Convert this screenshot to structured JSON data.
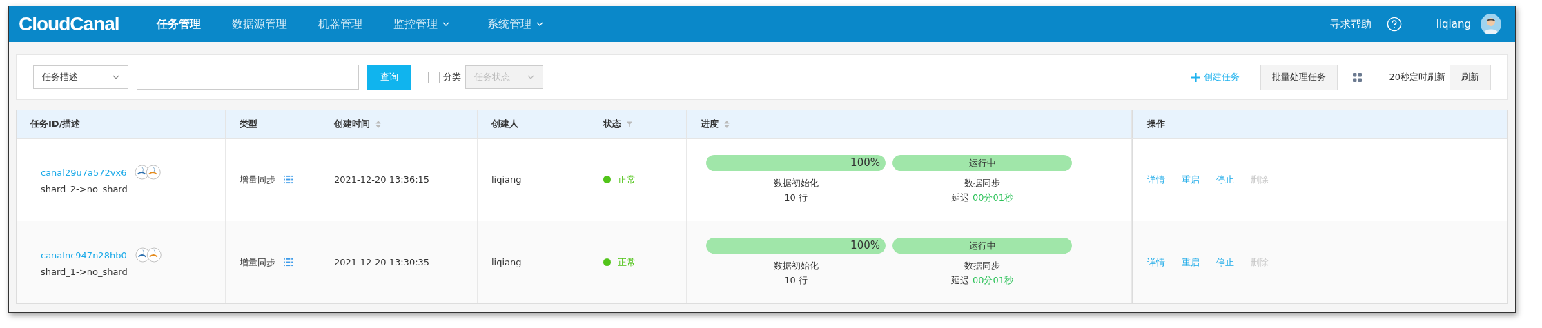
{
  "header": {
    "logo": "CloudCanal",
    "nav": [
      {
        "label": "任务管理",
        "selected": true,
        "dropdown": false
      },
      {
        "label": "数据源管理",
        "selected": false,
        "dropdown": false
      },
      {
        "label": "机器管理",
        "selected": false,
        "dropdown": false
      },
      {
        "label": "监控管理",
        "selected": false,
        "dropdown": true
      },
      {
        "label": "系统管理",
        "selected": false,
        "dropdown": true
      }
    ],
    "help": "寻求帮助",
    "user": "liqiang"
  },
  "toolbar": {
    "filter_select": "任务描述",
    "query_button": "查询",
    "category": {
      "label": "分类",
      "checked": false
    },
    "status_select": {
      "placeholder": "任务状态",
      "disabled": true
    },
    "create_button": "创建任务",
    "batch_button": "批量处理任务",
    "auto_refresh": {
      "label": "20秒定时刷新",
      "checked": false
    },
    "refresh_button": "刷新"
  },
  "table": {
    "columns": [
      {
        "label": "任务ID/描述",
        "sort": false,
        "filter": false
      },
      {
        "label": "类型",
        "sort": false,
        "filter": false
      },
      {
        "label": "创建时间",
        "sort": true,
        "filter": false
      },
      {
        "label": "创建人",
        "sort": false,
        "filter": false
      },
      {
        "label": "状态",
        "sort": false,
        "filter": true
      },
      {
        "label": "进度",
        "sort": true,
        "filter": false
      },
      {
        "label": "操作",
        "sort": false,
        "filter": false
      }
    ],
    "rows": [
      {
        "id": "canal29u7a572vx6",
        "desc": "shard_2->no_shard",
        "type": "增量同步",
        "created": "2021-12-20 13:36:15",
        "creator": "liqiang",
        "status": {
          "label": "正常",
          "color": "#52c41a"
        },
        "init": {
          "bar_text": "100%",
          "level": 1,
          "label": "数据初始化",
          "detail": "10 行"
        },
        "sync": {
          "bar_text": "运行中",
          "level": 1,
          "label": "数据同步",
          "delay_label": "延迟",
          "delay": "00分01秒"
        },
        "actions": [
          {
            "label": "详情",
            "disabled": false
          },
          {
            "label": "重启",
            "disabled": false
          },
          {
            "label": "停止",
            "disabled": false
          },
          {
            "label": "删除",
            "disabled": true
          }
        ]
      },
      {
        "id": "canalnc947n28hb0",
        "desc": "shard_1->no_shard",
        "type": "增量同步",
        "created": "2021-12-20 13:30:35",
        "creator": "liqiang",
        "status": {
          "label": "正常",
          "color": "#52c41a"
        },
        "init": {
          "bar_text": "100%",
          "level": 1,
          "label": "数据初始化",
          "detail": "10 行"
        },
        "sync": {
          "bar_text": "运行中",
          "level": 1,
          "label": "数据同步",
          "delay_label": "延迟",
          "delay": "00分01秒"
        },
        "actions": [
          {
            "label": "详情",
            "disabled": false
          },
          {
            "label": "重启",
            "disabled": false
          },
          {
            "label": "停止",
            "disabled": false
          },
          {
            "label": "删除",
            "disabled": true
          }
        ]
      }
    ]
  }
}
